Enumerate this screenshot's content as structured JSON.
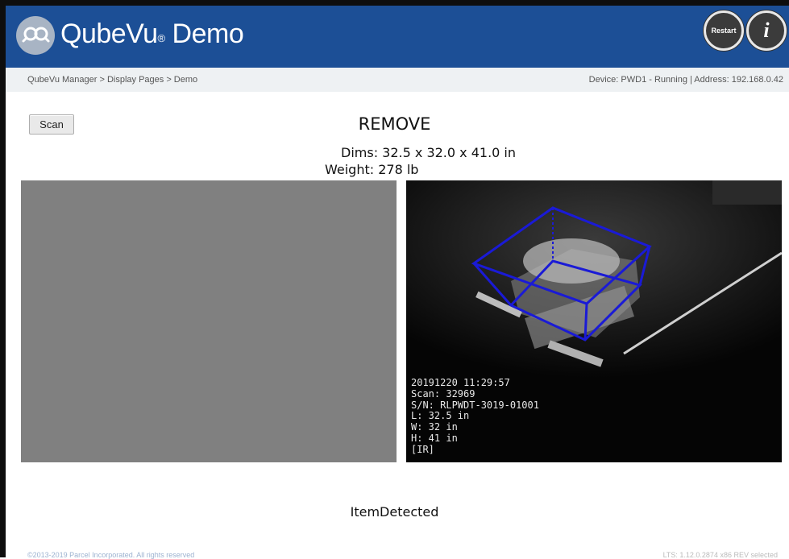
{
  "header": {
    "app_title": "QubeVu",
    "registered_mark": "®",
    "app_subtitle": "Demo",
    "restart_label": "Restart",
    "info_label": "i"
  },
  "breadcrumb": {
    "path": "QubeVu Manager > Display Pages > Demo",
    "device_status": "Device: PWD1 - Running | Address: 192.168.0.42"
  },
  "main": {
    "scan_button_label": "Scan",
    "status_title": "REMOVE",
    "dims_label": "Dims:",
    "dims_value": "32.5 x 32.0 x 41.0 in",
    "weight_label": "Weight:",
    "weight_value": "278 lb",
    "camera_overlay": {
      "timestamp": "20191220 11:29:57",
      "scan": "Scan: 32969",
      "serial": "S/N: RLPWDT-3019-01001",
      "length": "L: 32.5 in",
      "width": "W: 32 in",
      "height": "H: 41 in",
      "mode": "[IR]"
    },
    "detection_status": "ItemDetected"
  },
  "footer": {
    "copyright": "©2013-2019 Parcel Incorporated. All rights reserved",
    "version": "LTS: 1.12.0.2874 x86 REV selected"
  },
  "colors": {
    "header_bg": "#1c4f96",
    "breadcrumb_bg": "#eef1f3",
    "bounding_box": "#1a1ad6"
  },
  "icons": {
    "logo": "qubevu-logo-icon",
    "restart": "restart-icon",
    "info": "info-icon"
  }
}
